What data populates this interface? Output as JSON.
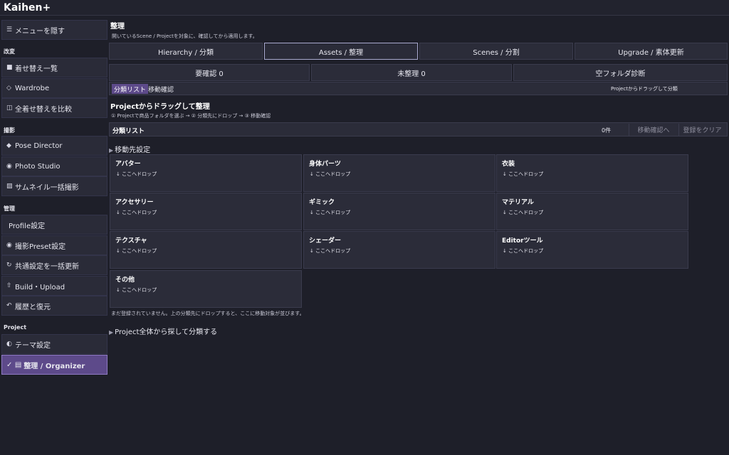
{
  "app": {
    "title": "Kaihen+"
  },
  "sidebar": {
    "hide_menu": {
      "icon": "☰",
      "label": "メニューを隠す"
    },
    "sections": {
      "kaihen": "改変",
      "satsuei": "撮影",
      "kanri": "管理",
      "project": "Project"
    },
    "items": [
      {
        "icon": "■",
        "label": "着せ替え一覧"
      },
      {
        "icon": "◇",
        "label": "Wardrobe"
      },
      {
        "icon": "◫",
        "label": "全着せ替えを比較"
      },
      {
        "icon": "◆",
        "label": "Pose Director"
      },
      {
        "icon": "◉",
        "label": "Photo Studio"
      },
      {
        "icon": "▨",
        "label": "サムネイル一括撮影"
      },
      {
        "icon": "",
        "label": "Profile設定"
      },
      {
        "icon": "◉",
        "label": "撮影Preset設定"
      },
      {
        "icon": "↻",
        "label": "共通設定を一括更新"
      },
      {
        "icon": "⇧",
        "label": "Build・Upload"
      },
      {
        "icon": "↶",
        "label": "履歴と復元"
      },
      {
        "icon": "◐",
        "label": "テーマ設定"
      },
      {
        "icon": "✓ ▤",
        "label": "整理 / Organizer"
      }
    ]
  },
  "main": {
    "title": "整理",
    "subtitle": "開いているScene / Projectを対象に、確認してから適用します。",
    "tabs": [
      "Hierarchy / 分類",
      "Assets / 整理",
      "Scenes / 分割",
      "Upgrade / 素体更新"
    ],
    "stats": [
      "要確認 0",
      "未整理 0",
      "空フォルダ診断"
    ],
    "subtabs": {
      "active": "分類リスト",
      "other": "移動確認",
      "hint": "Projectからドラッグして分類"
    },
    "section_title": "Projectからドラッグして整理",
    "steps": "① Projectで商品フォルダを選ぶ → ② 分類先にドロップ → ③ 移動確認",
    "list": {
      "title": "分類リスト",
      "count": "0件",
      "move_confirm": "移動確認へ",
      "clear": "登録をクリア"
    },
    "destinations_label": "移動先設定",
    "drop_hint": "↓ ここへドロップ",
    "categories": [
      "アバター",
      "身体パーツ",
      "衣装",
      "アクセサリー",
      "ギミック",
      "マテリアル",
      "テクスチャ",
      "シェーダー",
      "Editorツール",
      "その他"
    ],
    "empty_note": "まだ登録されていません。上の分類先にドロップすると、ここに移動対象が並びます。",
    "search_project": "Project全体から探して分類する"
  },
  "colors": {
    "background": "#1e1f29",
    "panel": "#2b2c39",
    "accent": "#5d4a8a",
    "accent_border": "#8f7ac4"
  }
}
